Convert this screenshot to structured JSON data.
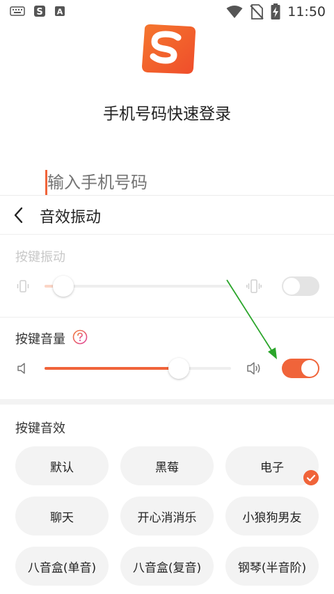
{
  "status_bar": {
    "time": "11:50"
  },
  "login": {
    "title": "手机号码快速登录",
    "phone_placeholder": "输入手机号码"
  },
  "sheet": {
    "title": "音效振动",
    "vibration": {
      "label": "按键振动",
      "level": 0.1,
      "enabled": false
    },
    "volume": {
      "label": "按键音量",
      "level": 0.72,
      "enabled": true
    },
    "sound_effects": {
      "label": "按键音效",
      "options": [
        "默认",
        "黑莓",
        "电子",
        "聊天",
        "开心消消乐",
        "小狼狗男友",
        "八音盒(单音)",
        "八音盒(复音)",
        "钢琴(半音阶)"
      ],
      "selected": "电子"
    }
  },
  "colors": {
    "accent": "#f0643a",
    "chip_bg": "#f3f3f3",
    "annotation_arrow": "#2aa52a"
  }
}
